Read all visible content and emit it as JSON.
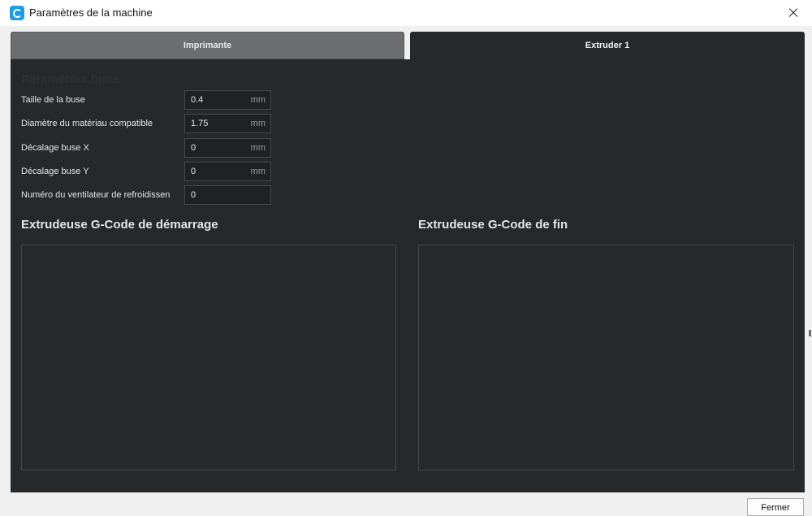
{
  "window": {
    "title": "Paramètres de la machine",
    "app_icon": "cura-logo-icon",
    "close_icon": "close-icon"
  },
  "tabs": [
    {
      "label": "Imprimante",
      "active": false
    },
    {
      "label": "Extruder 1",
      "active": true
    }
  ],
  "nozzle_section": {
    "title": "Paramètres buse",
    "fields": [
      {
        "label": "Taille de la buse",
        "value": "0.4",
        "unit": "mm"
      },
      {
        "label": "Diamètre du matériau compatible",
        "value": "1.75",
        "unit": "mm"
      },
      {
        "label": "Décalage buse X",
        "value": "0",
        "unit": "mm"
      },
      {
        "label": "Décalage buse Y",
        "value": "0",
        "unit": "mm"
      },
      {
        "label": "Numéro du ventilateur de refroidissen",
        "value": "0",
        "unit": ""
      }
    ]
  },
  "gcode": {
    "start_title": "Extrudeuse G-Code de démarrage",
    "end_title": "Extrudeuse G-Code de fin",
    "start_value": "",
    "end_value": ""
  },
  "footer": {
    "close_label": "Fermer"
  },
  "colors": {
    "panel_bg": "#26292c",
    "tab_inactive_bg": "#6b6d6f",
    "accent": "#1e9be6"
  }
}
